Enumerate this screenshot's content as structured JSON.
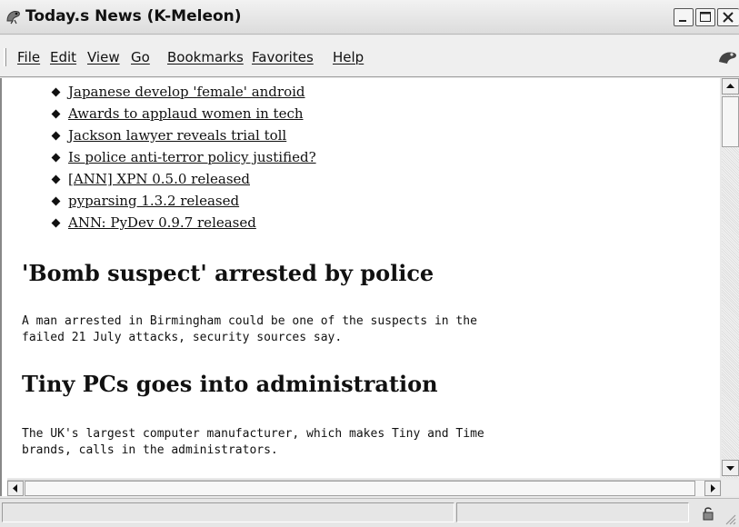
{
  "window": {
    "title": "Today.s News (K-Meleon)"
  },
  "menu": {
    "items": [
      "File",
      "Edit",
      "View",
      "Go",
      "Bookmarks",
      "Favorites",
      "Help"
    ]
  },
  "headlines": [
    "Japanese develop 'female' android",
    "Awards to applaud women in tech",
    "Jackson lawyer reveals trial toll",
    "Is police anti-terror policy justified?",
    "[ANN] XPN 0.5.0 released",
    "pyparsing 1.3.2 released",
    "ANN: PyDev 0.9.7 released"
  ],
  "stories": [
    {
      "title": "'Bomb suspect' arrested by police",
      "lines": [
        "A man arrested in Birmingham could be one of the suspects in the",
        "failed 21 July attacks, security sources say."
      ]
    },
    {
      "title": "Tiny PCs goes into administration",
      "lines": [
        "The UK's largest computer manufacturer, which makes Tiny and Time",
        "brands, calls in the administrators."
      ]
    }
  ],
  "colors": {
    "text": "#111111",
    "chrome": "#efefef"
  },
  "icons": {
    "app": "k-meleon-icon",
    "minimize": "minimize-icon",
    "maximize": "maximize-icon",
    "close": "close-icon",
    "throbber": "throbber-icon",
    "scroll_up": "arrow-up-icon",
    "scroll_down": "arrow-down-icon",
    "scroll_left": "arrow-left-icon",
    "scroll_right": "arrow-right-icon",
    "lock": "lock-icon",
    "resize": "resize-grip-icon"
  }
}
